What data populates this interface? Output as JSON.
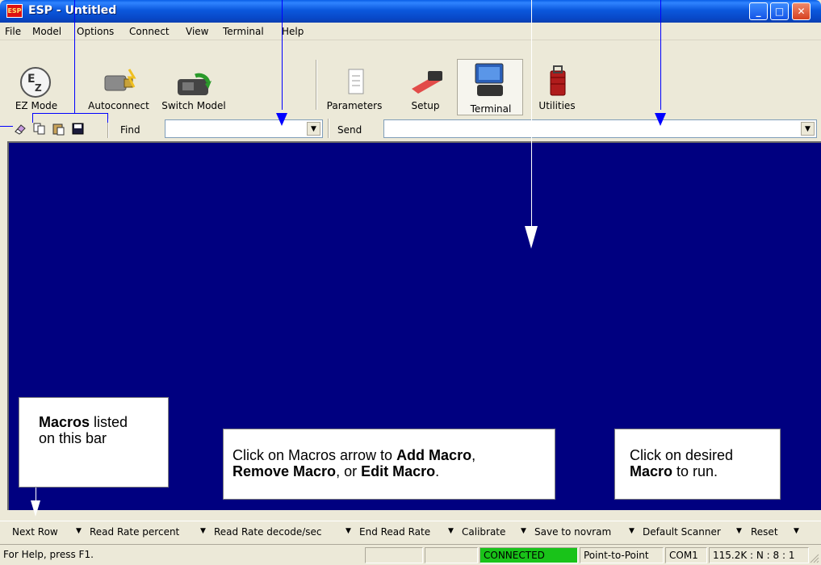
{
  "window": {
    "title": "ESP - Untitled",
    "app_icon": "ESP"
  },
  "menu": [
    "File",
    "Model",
    "Options",
    "Connect",
    "View",
    "Terminal",
    "Help"
  ],
  "toolbar": {
    "ez_mode": "EZ Mode",
    "autoconnect": "Autoconnect",
    "switch_model": "Switch Model",
    "parameters": "Parameters",
    "setup": "Setup",
    "terminal": "Terminal",
    "utilities": "Utilities"
  },
  "find": {
    "label": "Find",
    "value": ""
  },
  "send": {
    "label": "Send",
    "value": ""
  },
  "callouts": {
    "macros_bar_bold": "Macros",
    "macros_bar_text1": " listed",
    "macros_bar_text2": "on this bar",
    "add_line1_pre": "Click on Macros arrow to ",
    "add_macro": "Add Macro",
    "add_line1_post": ",",
    "remove_macro": "Remove Macro",
    "add_line2_mid": ", or ",
    "edit_macro": "Edit Macro",
    "add_line2_post": ".",
    "run_line1": "Click on desired",
    "run_macro": "Macro",
    "run_line2_post": " to run."
  },
  "macros": [
    "Next Row",
    "Read Rate percent",
    "Read Rate decode/sec",
    "End Read Rate",
    "Calibrate",
    "Save to novram",
    "Default Scanner",
    "Reset"
  ],
  "status": {
    "help": "For Help, press F1.",
    "connection": "CONNECTED",
    "mode": "Point-to-Point",
    "port": "COM1",
    "settings": "115.2K : N : 8 : 1"
  },
  "colors": {
    "terminal_bg": "#000080",
    "connected_bg": "#19c319",
    "callout_line": "#0000ff"
  }
}
